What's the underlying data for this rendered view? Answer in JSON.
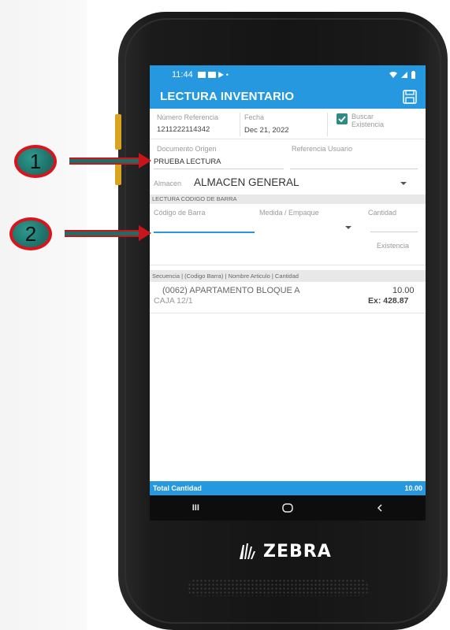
{
  "status_bar": {
    "time": "11:44"
  },
  "app_bar": {
    "title": "LECTURA INVENTARIO",
    "save_icon": "save-icon"
  },
  "form": {
    "numero_referencia": {
      "label": "Número Referencia",
      "value": "1211222114342"
    },
    "fecha": {
      "label": "Fecha",
      "value": "Dec 21, 2022"
    },
    "buscar_existencia": {
      "label_line1": "Buscar",
      "label_line2": "Existencia",
      "checked": true
    },
    "documento_origen": {
      "label": "Documento Origen",
      "value": "PRUEBA LECTURA"
    },
    "referencia_usuario": {
      "label": "Referencia Usuario",
      "value": ""
    },
    "almacen": {
      "label": "Almacen",
      "value": "ALMACEN GENERAL"
    }
  },
  "barcode_section": {
    "header": "LECTURA CODIGO DE BARRA",
    "codigo_label": "Código de Barra",
    "medida_label": "Medida / Empaque",
    "cantidad_label": "Cantidad",
    "existencia_label": "Existencia"
  },
  "list": {
    "header": "Secuencia | (Codigo Barra) | Nombre Articulo | Cantidad",
    "items": [
      {
        "name": "(0062) APARTAMENTO BLOQUE A",
        "quantity": "10.00",
        "unit": "CAJA 12/1",
        "existencia": "Ex: 428.87"
      }
    ]
  },
  "total": {
    "label": "Total Cantidad",
    "value": "10.00"
  },
  "nav": {
    "recent": "III",
    "home": "O",
    "back": "<"
  },
  "brand": {
    "name": "ZEBRA"
  },
  "callouts": [
    "1",
    "2"
  ],
  "colors": {
    "accent": "#2698e0",
    "checkbox": "#2e8b83",
    "callout_fill": "#1c6e66",
    "callout_border": "#d8141c"
  }
}
